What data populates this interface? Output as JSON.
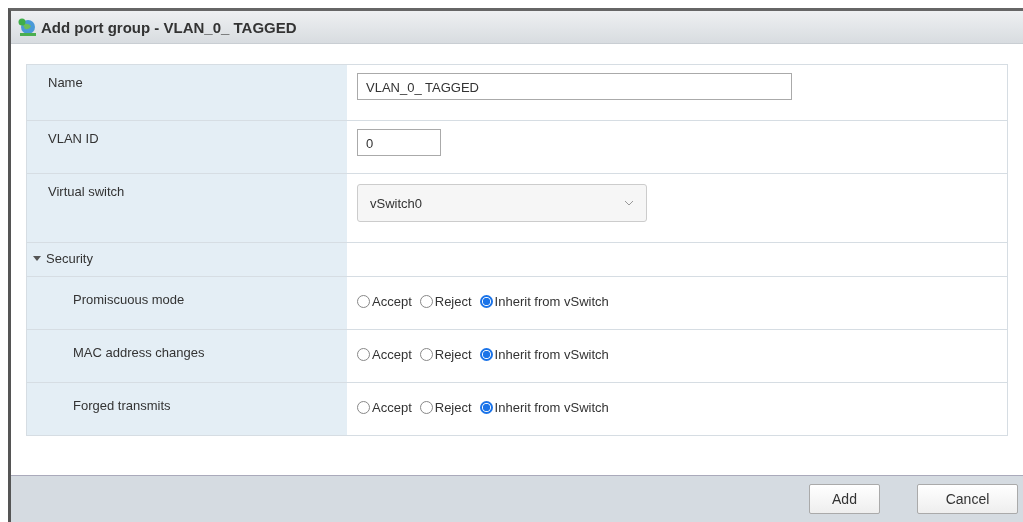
{
  "window": {
    "title": "Add port group - VLAN_0_ TAGGED"
  },
  "fields": [
    {
      "label": "Name",
      "kind": "text",
      "value": "VLAN_0_ TAGGED"
    },
    {
      "label": "VLAN ID",
      "kind": "short",
      "value": "0"
    },
    {
      "label": "Virtual switch",
      "kind": "select",
      "value": "vSwitch0"
    }
  ],
  "security": {
    "label": "Security",
    "expanded": true,
    "rows": [
      {
        "label": "Promiscuous mode",
        "options": [
          {
            "label": "Accept",
            "selected": false
          },
          {
            "label": "Reject",
            "selected": false
          },
          {
            "label": "Inherit from vSwitch",
            "selected": true
          }
        ]
      },
      {
        "label": "MAC address changes",
        "options": [
          {
            "label": "Accept",
            "selected": false
          },
          {
            "label": "Reject",
            "selected": false
          },
          {
            "label": "Inherit from vSwitch",
            "selected": true
          }
        ]
      },
      {
        "label": "Forged transmits",
        "options": [
          {
            "label": "Accept",
            "selected": false
          },
          {
            "label": "Reject",
            "selected": false
          },
          {
            "label": "Inherit from vSwitch",
            "selected": true
          }
        ]
      }
    ]
  },
  "buttons": [
    "Add",
    "Cancel"
  ]
}
